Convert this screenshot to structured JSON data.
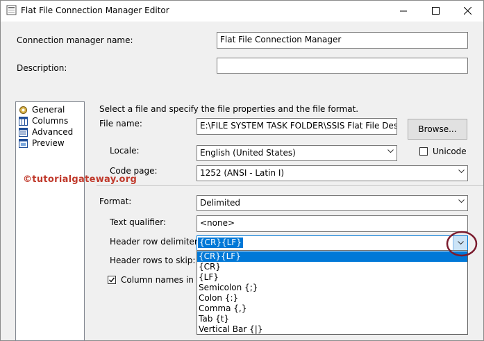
{
  "window": {
    "title": "Flat File Connection Manager Editor"
  },
  "form": {
    "connection_manager_name_label": "Connection manager name:",
    "connection_manager_name_value": "Flat File Connection Manager",
    "description_label": "Description:",
    "description_value": ""
  },
  "nav": {
    "items": [
      {
        "label": "General",
        "icon": "general-icon"
      },
      {
        "label": "Columns",
        "icon": "columns-icon"
      },
      {
        "label": "Advanced",
        "icon": "advanced-icon"
      },
      {
        "label": "Preview",
        "icon": "preview-icon"
      }
    ]
  },
  "general": {
    "intro": "Select a file and specify the file properties and the file format.",
    "file_name_label": "File name:",
    "file_name_value": "E:\\FILE SYSTEM TASK FOLDER\\SSIS Flat File Destination",
    "browse_label": "Browse...",
    "locale_label": "Locale:",
    "locale_value": "English (United States)",
    "unicode_label": "Unicode",
    "code_page_label": "Code page:",
    "code_page_value": "1252  (ANSI - Latin I)",
    "format_label": "Format:",
    "format_value": "Delimited",
    "text_qualifier_label": "Text qualifier:",
    "text_qualifier_value": "<none>",
    "header_row_delimiter_label": "Header row delimiter:",
    "header_row_delimiter_value": "{CR}{LF}",
    "header_rows_to_skip_label": "Header rows to skip:",
    "column_names_label": "Column names in th"
  },
  "dropdown": {
    "options": [
      "{CR}{LF}",
      "{CR}",
      "{LF}",
      "Semicolon {;}",
      "Colon {:}",
      "Comma {,}",
      "Tab {t}",
      "Vertical Bar {|}"
    ],
    "selected_index": 0
  },
  "watermark": "©tutorialgateway.org",
  "colors": {
    "selection": "#0078d7",
    "highlight_circle": "#7b1c2e",
    "watermark": "#c0392b"
  }
}
